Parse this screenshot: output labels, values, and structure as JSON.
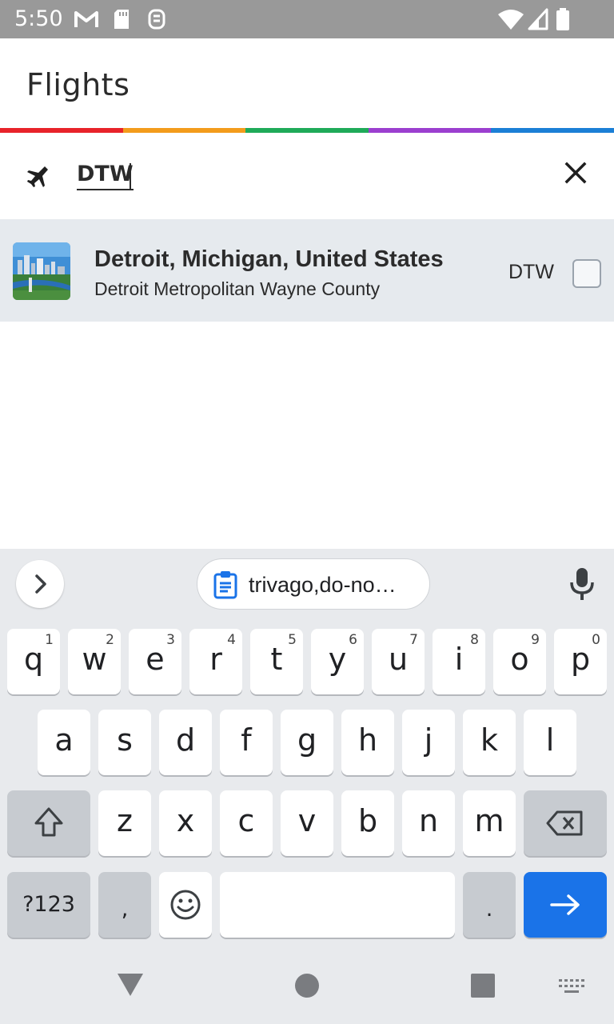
{
  "status_bar": {
    "time": "5:50",
    "icons": [
      "gmail-icon",
      "sd-card-icon",
      "cast-icon",
      "wifi-icon",
      "signal-icon",
      "battery-icon"
    ]
  },
  "header": {
    "title": "Flights"
  },
  "rainbow_colors": [
    "#e8232a",
    "#f39c1c",
    "#1faa59",
    "#9b3fcf",
    "#1b7fd6"
  ],
  "search": {
    "value": "DTW"
  },
  "results": [
    {
      "city": "Detroit, Michigan, United States",
      "airport": "Detroit Metropolitan Wayne County",
      "code": "DTW",
      "checked": false
    }
  ],
  "keyboard": {
    "clipboard_text": "trivago,do-no…",
    "rows": [
      [
        {
          "key": "q",
          "num": "1"
        },
        {
          "key": "w",
          "num": "2"
        },
        {
          "key": "e",
          "num": "3"
        },
        {
          "key": "r",
          "num": "4"
        },
        {
          "key": "t",
          "num": "5"
        },
        {
          "key": "y",
          "num": "6"
        },
        {
          "key": "u",
          "num": "7"
        },
        {
          "key": "i",
          "num": "8"
        },
        {
          "key": "o",
          "num": "9"
        },
        {
          "key": "p",
          "num": "0"
        }
      ],
      [
        {
          "key": "a"
        },
        {
          "key": "s"
        },
        {
          "key": "d"
        },
        {
          "key": "f"
        },
        {
          "key": "g"
        },
        {
          "key": "h"
        },
        {
          "key": "j"
        },
        {
          "key": "k"
        },
        {
          "key": "l"
        }
      ],
      [
        {
          "key": "z"
        },
        {
          "key": "x"
        },
        {
          "key": "c"
        },
        {
          "key": "v"
        },
        {
          "key": "b"
        },
        {
          "key": "n"
        },
        {
          "key": "m"
        }
      ]
    ],
    "symbols_label": "?123",
    "comma_label": ",",
    "period_label": ".",
    "enter_color": "#1a73e8"
  }
}
